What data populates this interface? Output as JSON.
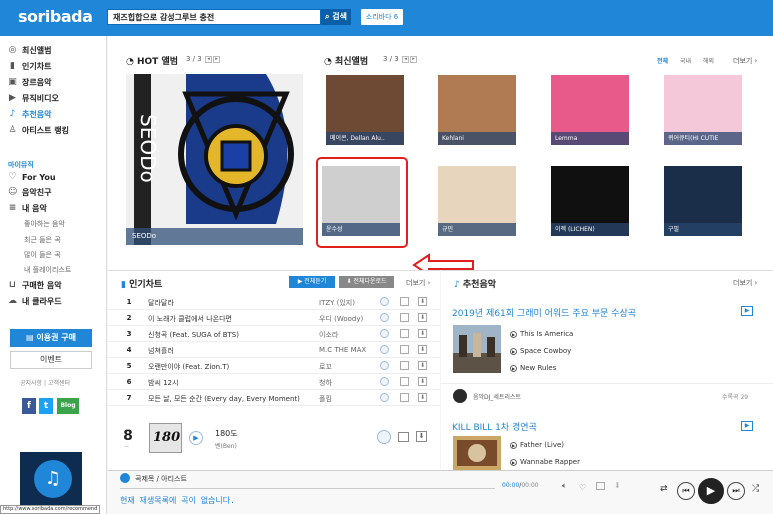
{
  "header": {
    "logo": "soribada",
    "search_value": "재즈힙합으로 감성그루브 충전",
    "search_button": "검색",
    "soribada6": "소리바다 6"
  },
  "sidebar": {
    "items": [
      {
        "label": "최신앨범",
        "icon": "disc-icon"
      },
      {
        "label": "인기차트",
        "icon": "bar-chart-icon"
      },
      {
        "label": "장르음악",
        "icon": "genre-icon"
      },
      {
        "label": "뮤직비디오",
        "icon": "video-icon"
      },
      {
        "label": "추천음악",
        "icon": "music-note-icon"
      },
      {
        "label": "아티스트 랭킹",
        "icon": "user-icon"
      }
    ],
    "my_music_title": "마이뮤직",
    "my_items": [
      {
        "label": "For You",
        "icon": "heart-icon"
      },
      {
        "label": "음악친구",
        "icon": "friends-icon"
      },
      {
        "label": "내 음악",
        "icon": "list-icon"
      }
    ],
    "sub_items": [
      "좋아하는 음악",
      "최근 들은 곡",
      "많이 들은 곡",
      "내 플레이리스트"
    ],
    "extra_items": [
      {
        "label": "구매한 음악",
        "icon": "cart-icon"
      },
      {
        "label": "내 클라우드",
        "icon": "cloud-icon"
      }
    ],
    "purchase_button": "이용권 구매",
    "event_button": "이벤트",
    "links": [
      "공지사항",
      "고객센터"
    ],
    "sns": [
      "f",
      "t",
      "Blog"
    ],
    "status_url": "http://www.soribada.com/recommend"
  },
  "hot": {
    "title": "HOT 앨범",
    "pager": "3 / 3",
    "cover_label": "SEODo"
  },
  "latest": {
    "title": "최신앨범",
    "pager": "3 / 3",
    "filters": [
      "전체",
      "국내",
      "해외"
    ],
    "more": "더보기",
    "albums": [
      {
        "label": "메이콘, Dellan Alu..",
        "color": "#6e4a34"
      },
      {
        "label": "Kehlani",
        "color": "#b07a53"
      },
      {
        "label": "Lemma",
        "color": "#e85a8a"
      },
      {
        "label": "퀴어큐티(HI CUTIE",
        "color": "#f4c8d8"
      },
      {
        "label": "윤수성",
        "color": "#cfcfcf"
      },
      {
        "label": "규민",
        "color": "#e8d5bd"
      },
      {
        "label": "이젝 (LICHEN)",
        "color": "#101010"
      },
      {
        "label": "구필",
        "color": "#1a2e4a"
      }
    ]
  },
  "chart": {
    "title": "인기차트",
    "play_all": "전체듣기",
    "download_all": "전체다운로드",
    "more": "더보기",
    "rows": [
      {
        "rank": "1",
        "song": "달라달라",
        "artist": "ITZY (있지)"
      },
      {
        "rank": "2",
        "song": "이 노래가 클럽에서 나온다면",
        "artist": "우디 (Woody)"
      },
      {
        "rank": "3",
        "song": "신청곡 (Feat. SUGA of BTS)",
        "artist": "이소라"
      },
      {
        "rank": "4",
        "song": "넘쳐흘러",
        "artist": "M.C THE MAX"
      },
      {
        "rank": "5",
        "song": "오랜만이야 (Feat. Zion.T)",
        "artist": "로꼬"
      },
      {
        "rank": "6",
        "song": "밤씨 12시",
        "artist": "청하"
      },
      {
        "rank": "7",
        "song": "모든 날, 모든 순간 (Every day, Every Moment)",
        "artist": "폴킴"
      }
    ],
    "featured": {
      "rank": "8",
      "song": "180도",
      "artist": "벤(Ben)",
      "cover_text": "180"
    }
  },
  "recommend": {
    "title": "추천음악",
    "more": "더보기",
    "playlist1": {
      "title": "2019년 제61회 그래미 어워드 주요 부문 수상곡",
      "tracks": [
        "This Is America",
        "Space Cowboy",
        "New Rules"
      ]
    },
    "curator": {
      "name": "음악DJ_세트리스트",
      "count": "수록곡 29"
    },
    "playlist2": {
      "title": "KILL BILL 1차 경연곡",
      "tracks": [
        "Father (Live)",
        "Wannabe Rapper"
      ]
    }
  },
  "player": {
    "title": "곡제목 / 아티스트",
    "status": "현재 재생목록에 곡이 없습니다.",
    "time_current": "00:00",
    "time_total": "00:00"
  }
}
